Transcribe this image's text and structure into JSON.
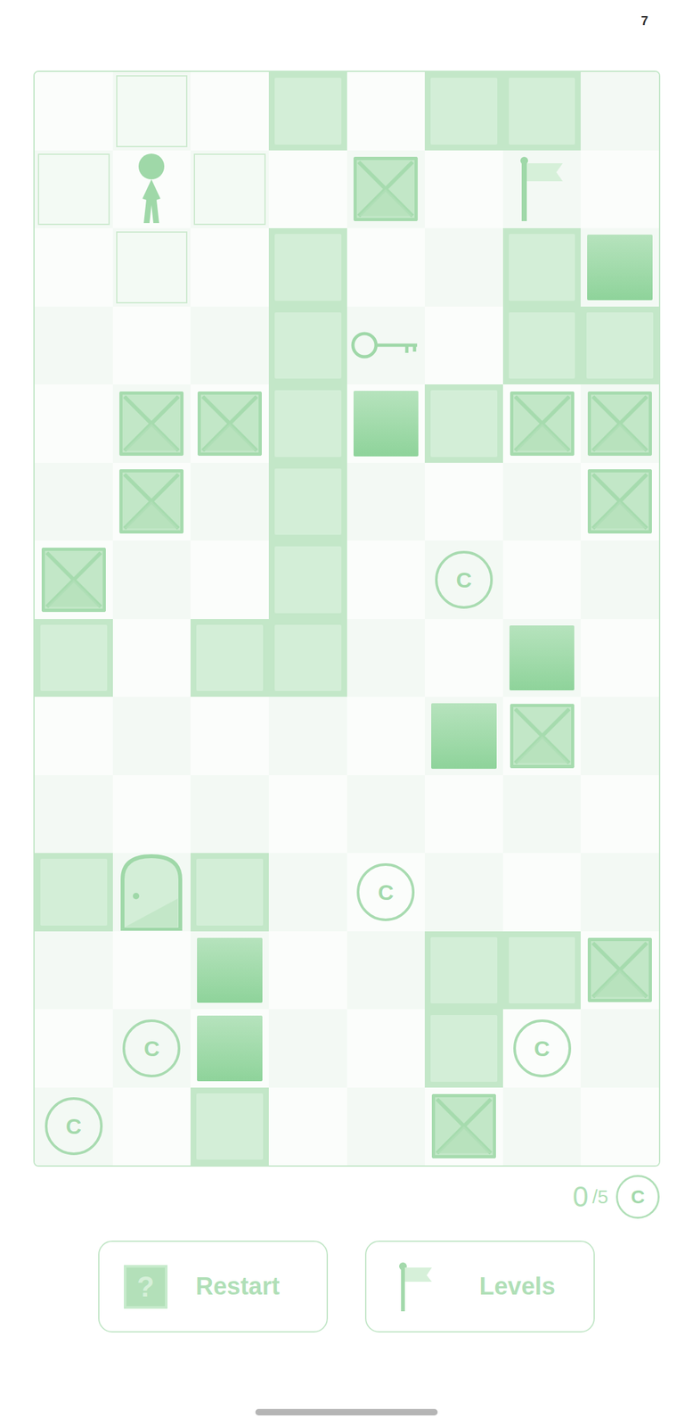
{
  "level_indicator": "7",
  "grid": {
    "coin_symbol": "C",
    "rows": [
      [
        "empty",
        "outline",
        "empty",
        "wall",
        "empty",
        "wall",
        "wall",
        "empty"
      ],
      [
        "outline",
        "player",
        "outline",
        "empty",
        "crate",
        "empty",
        "flag",
        "empty"
      ],
      [
        "empty",
        "outline",
        "empty",
        "wall",
        "empty",
        "empty",
        "wall",
        "solid"
      ],
      [
        "empty",
        "empty",
        "empty",
        "wall",
        "key",
        "empty",
        "wall",
        "wall"
      ],
      [
        "empty",
        "crate",
        "crate",
        "wall",
        "solid",
        "wall",
        "crate",
        "crate"
      ],
      [
        "empty",
        "crate",
        "empty",
        "wall",
        "empty",
        "empty",
        "empty",
        "crate"
      ],
      [
        "crate",
        "empty",
        "empty",
        "wall",
        "empty",
        "coin",
        "empty",
        "empty"
      ],
      [
        "wall",
        "empty",
        "wall",
        "wall",
        "empty",
        "empty",
        "solid",
        "empty"
      ],
      [
        "empty",
        "empty",
        "empty",
        "empty",
        "empty",
        "solid",
        "crate",
        "empty"
      ],
      [
        "empty",
        "empty",
        "empty",
        "empty",
        "empty",
        "empty",
        "empty",
        "empty"
      ],
      [
        "wall",
        "door",
        "wall",
        "empty",
        "coin",
        "empty",
        "empty",
        "empty"
      ],
      [
        "empty",
        "empty",
        "solid",
        "empty",
        "empty",
        "wall",
        "wall",
        "crate"
      ],
      [
        "empty",
        "coin",
        "solid",
        "empty",
        "empty",
        "wall",
        "coin",
        "empty"
      ],
      [
        "coin",
        "empty",
        "wall",
        "empty",
        "empty",
        "crate",
        "empty",
        "empty"
      ]
    ]
  },
  "coins": {
    "collected": "0",
    "total": "/5",
    "symbol": "C"
  },
  "buttons": [
    {
      "label": "Restart",
      "icon": "?"
    },
    {
      "label": "Levels"
    }
  ]
}
